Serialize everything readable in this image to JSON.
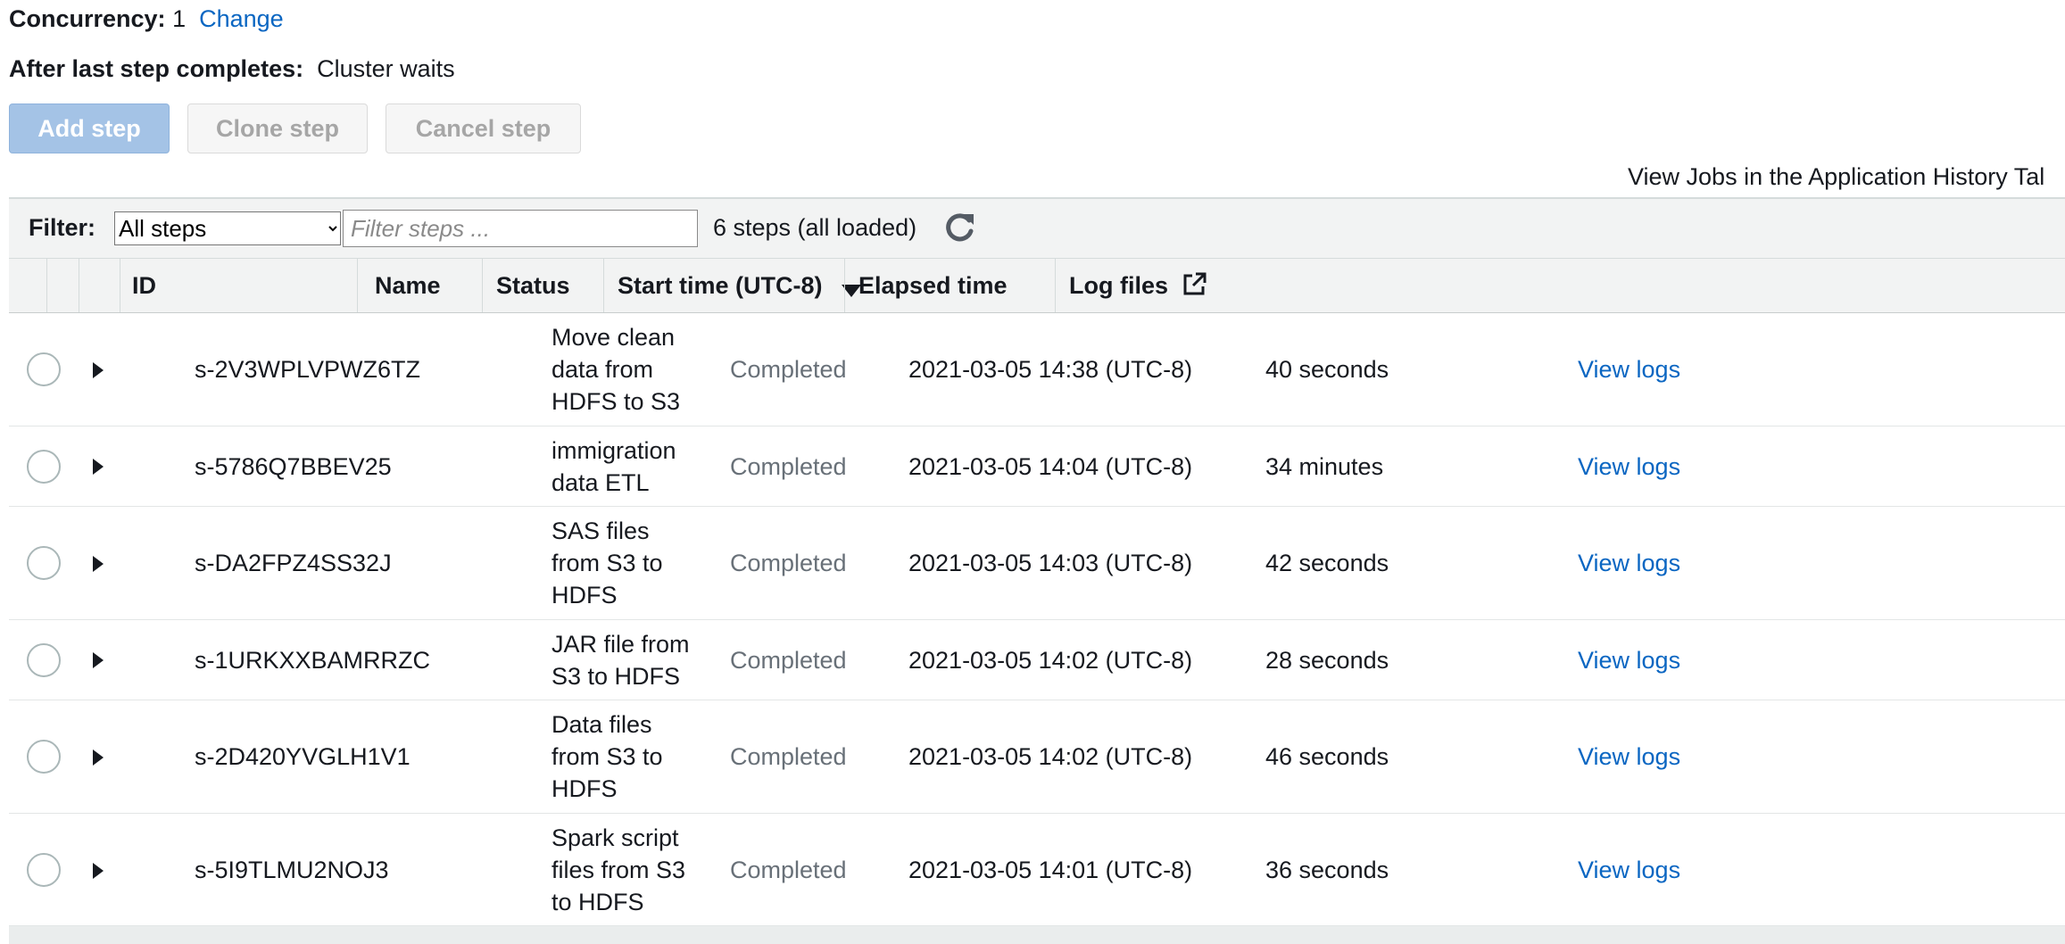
{
  "concurrency": {
    "label": "Concurrency:",
    "value": "1",
    "change_link": "Change"
  },
  "after_last": {
    "label": "After last step completes:",
    "value": "Cluster waits"
  },
  "buttons": {
    "add": "Add step",
    "clone": "Clone step",
    "cancel": "Cancel step"
  },
  "view_jobs_link": "View Jobs in the Application History Tal",
  "filter": {
    "label": "Filter:",
    "selected": "All steps",
    "placeholder": "Filter steps ...",
    "count": "6 steps (all loaded)"
  },
  "table": {
    "columns": {
      "id": "ID",
      "name": "Name",
      "status": "Status",
      "start": "Start time (UTC-8)",
      "elapsed": "Elapsed time",
      "logs": "Log files"
    },
    "rows": [
      {
        "id": "s-2V3WPLVPWZ6TZ",
        "name_lines": [
          "Move clean",
          "data from",
          "HDFS to S3"
        ],
        "status": "Completed",
        "start": "2021-03-05 14:38 (UTC-8)",
        "elapsed": "40 seconds",
        "logs": "View logs"
      },
      {
        "id": "s-5786Q7BBEV25",
        "name_lines": [
          "immigration",
          "data ETL"
        ],
        "status": "Completed",
        "start": "2021-03-05 14:04 (UTC-8)",
        "elapsed": "34 minutes",
        "logs": "View logs"
      },
      {
        "id": "s-DA2FPZ4SS32J",
        "name_lines": [
          "SAS files",
          "from S3 to",
          "HDFS"
        ],
        "status": "Completed",
        "start": "2021-03-05 14:03 (UTC-8)",
        "elapsed": "42 seconds",
        "logs": "View logs"
      },
      {
        "id": "s-1URKXXBAMRRZC",
        "name_lines": [
          "JAR file from",
          "S3 to HDFS"
        ],
        "status": "Completed",
        "start": "2021-03-05 14:02 (UTC-8)",
        "elapsed": "28 seconds",
        "logs": "View logs"
      },
      {
        "id": "s-2D420YVGLH1V1",
        "name_lines": [
          "Data files",
          "from S3 to",
          "HDFS"
        ],
        "status": "Completed",
        "start": "2021-03-05 14:02 (UTC-8)",
        "elapsed": "46 seconds",
        "logs": "View logs"
      },
      {
        "id": "s-5I9TLMU2NOJ3",
        "name_lines": [
          "Spark script",
          "files from S3",
          "to HDFS"
        ],
        "status": "Completed",
        "start": "2021-03-05 14:01 (UTC-8)",
        "elapsed": "36 seconds",
        "logs": "View logs"
      }
    ]
  }
}
